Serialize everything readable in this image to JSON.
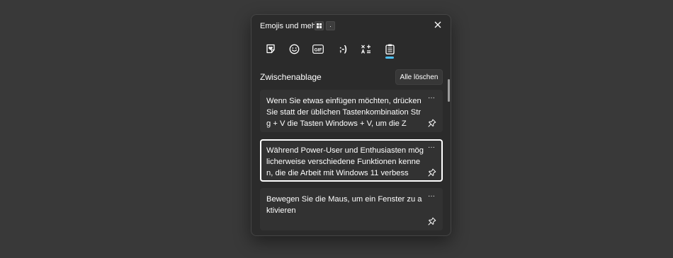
{
  "window": {
    "title": "Emojis und mehr",
    "shortcut_keys": [
      {
        "name": "windows-key",
        "icon": "windows-logo-icon"
      },
      {
        "name": "period-key",
        "label": "."
      }
    ],
    "close_icon": "close-icon"
  },
  "tabs": [
    {
      "id": "recent",
      "icon": "heart-sticker-icon",
      "selected": false
    },
    {
      "id": "emoji",
      "icon": "smiley-icon",
      "selected": false
    },
    {
      "id": "gif",
      "icon": "gif-icon",
      "label": "GIF",
      "selected": false
    },
    {
      "id": "kaomoji",
      "label": ";-)",
      "selected": false
    },
    {
      "id": "symbols",
      "icon": "symbols-icon",
      "selected": false
    },
    {
      "id": "clipboard",
      "icon": "clipboard-icon",
      "selected": true
    }
  ],
  "clipboard": {
    "section_title": "Zwischenablage",
    "clear_all_label": "Alle löschen",
    "items": [
      {
        "text": "Wenn Sie etwas einfügen möchten, drücken Sie statt der üblichen Tastenkombination Strg + V die Tasten Windows + V, um die Z",
        "selected": false,
        "more_label": "···"
      },
      {
        "text": "Während Power-User und Enthusiasten möglicherweise verschiedene Funktionen kennen, die die Arbeit mit Windows 11 verbess",
        "selected": true,
        "more_label": "···"
      },
      {
        "text": "Bewegen Sie die Maus, um ein Fenster zu aktivieren",
        "selected": false,
        "more_label": "···"
      }
    ]
  },
  "colors": {
    "background": "#393939",
    "panel": "#2b2b2b",
    "card": "#323232",
    "accent": "#4cc2ff"
  }
}
